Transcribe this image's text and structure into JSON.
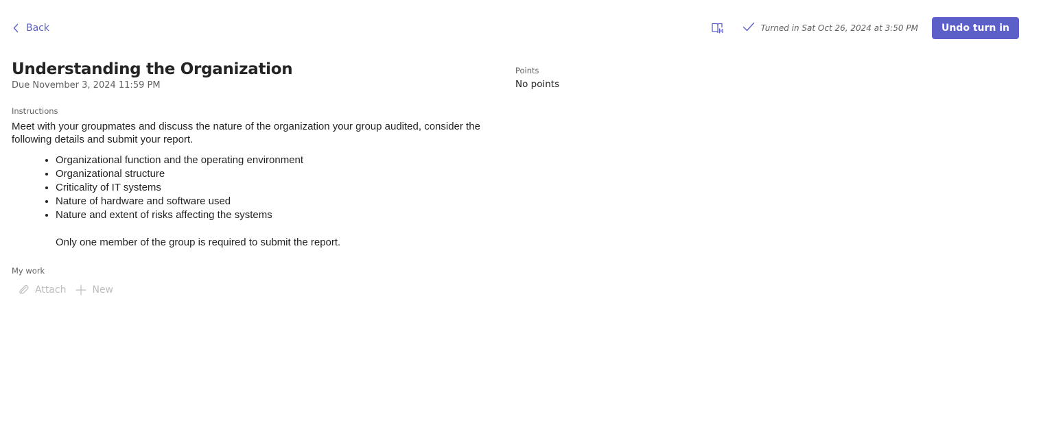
{
  "nav": {
    "back_label": "Back"
  },
  "header": {
    "reader_icon": "immersive-reader-icon",
    "turned_in_icon": "checkmark-icon",
    "turned_in_text": "Turned in Sat Oct 26, 2024 at 3:50 PM",
    "undo_label": "Undo turn in"
  },
  "assignment": {
    "title": "Understanding the Organization",
    "due": "Due November 3, 2024 11:59 PM",
    "instructions_label": "Instructions",
    "instructions_intro": "Meet with your groupmates and discuss the nature of the organization your group audited, consider the following details and submit your report.",
    "instructions_items": [
      "Organizational function and the operating environment",
      "Organizational structure",
      "Criticality of IT systems",
      "Nature of hardware and software used",
      "Nature and extent of risks affecting the systems"
    ],
    "instructions_note": "Only one member of the group is required to submit the report."
  },
  "points": {
    "label": "Points",
    "value": "No points"
  },
  "my_work": {
    "label": "My work",
    "attach_label": "Attach",
    "new_label": "New"
  },
  "colors": {
    "accent": "#5b5fc7",
    "text": "#242424",
    "secondary_text": "#616161",
    "disabled": "#bdbdbd"
  }
}
